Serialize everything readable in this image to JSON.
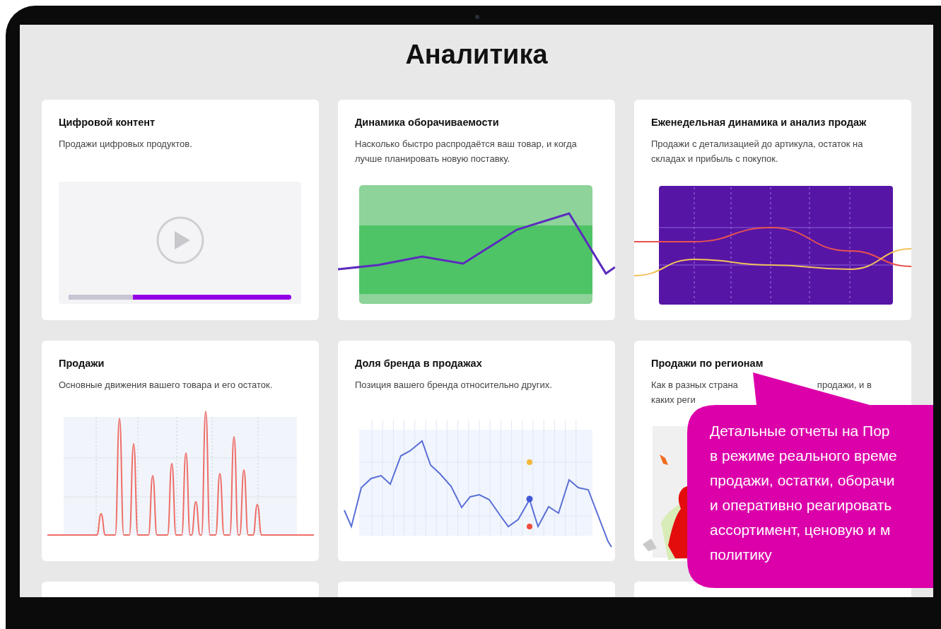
{
  "page": {
    "title": "Аналитика"
  },
  "cards": [
    {
      "kind": "video",
      "title": "Цифровой контент",
      "description": "Продажи цифровых продуктов.",
      "level": 0.29
    },
    {
      "kind": "turnover",
      "title": "Динамика оборачиваемости",
      "description": "Насколько быстро распродаётся ваш товар, и когда лучше планировать новую поставку."
    },
    {
      "kind": "weekly",
      "title": "Еженедельная динамика и анализ продаж",
      "description": "Продажи с детализацией до артикула, остаток на складах и прибыль с покупок."
    },
    {
      "kind": "sales",
      "title": "Продажи",
      "description": "Основные движения вашего товара и его остаток."
    },
    {
      "kind": "brand",
      "title": "Доля бренда в продажах",
      "description": "Позиция вашего бренда относительно других."
    },
    {
      "kind": "regions",
      "title": "Продажи по регионам",
      "description_fragments": [
        [
          "Как в разных страна",
          "продажи, и в"
        ],
        [
          "каких реги"
        ]
      ]
    },
    {
      "kind": "stub"
    },
    {
      "kind": "stub"
    },
    {
      "kind": "stub"
    }
  ],
  "callout": {
    "lines": [
      "Детальные отчеты на Пор",
      "в режиме реального време",
      "продажи, остатки, оборачи",
      "и оперативно реагировать",
      "ассортимент, ценовую и м",
      "политику"
    ]
  }
}
